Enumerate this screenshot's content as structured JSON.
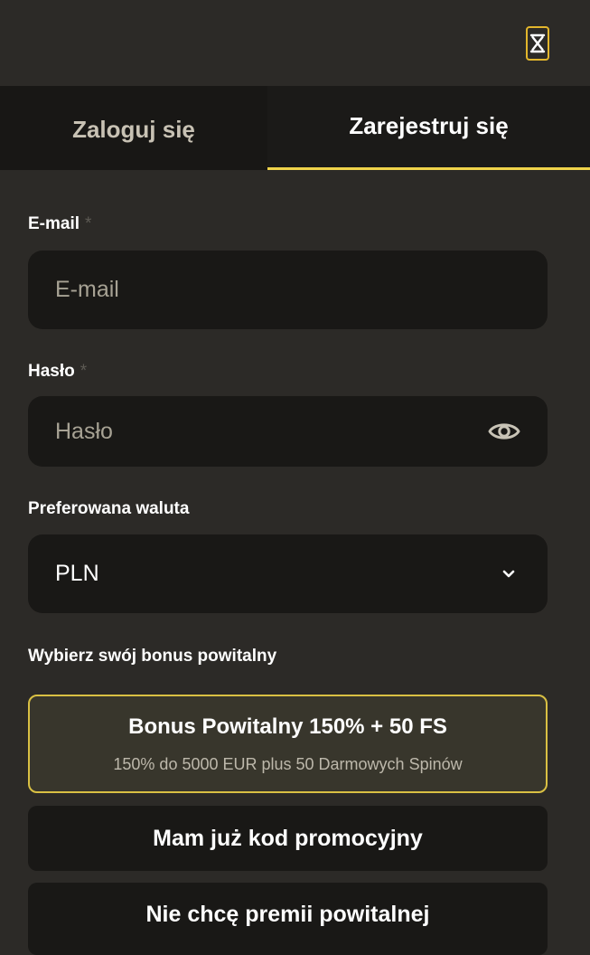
{
  "header": {
    "close_label": "Close"
  },
  "tabs": [
    {
      "label": "Zaloguj się",
      "active": false
    },
    {
      "label": "Zarejestruj się",
      "active": true
    }
  ],
  "form": {
    "email": {
      "label": "E-mail",
      "required_mark": "*",
      "placeholder": "E-mail",
      "value": ""
    },
    "password": {
      "label": "Hasło",
      "required_mark": "*",
      "placeholder": "Hasło",
      "value": "",
      "toggle_icon": "eye-icon"
    },
    "currency": {
      "label": "Preferowana waluta",
      "selected": "PLN",
      "icon": "chevron-down-icon"
    },
    "bonus": {
      "label": "Wybierz swój bonus powitalny",
      "options": [
        {
          "title": "Bonus Powitalny 150% + 50 FS",
          "subtitle": "150% do 5000 EUR plus 50 Darmowych Spinów",
          "selected": true
        },
        {
          "title": "Mam już kod promocyjny",
          "selected": false
        },
        {
          "title": "Nie chcę premii powitalnej",
          "selected": false
        }
      ]
    }
  },
  "colors": {
    "accent": "#f0d34a",
    "background": "#2c2a27",
    "field_background": "#191816",
    "selected_card_background": "#38362c"
  }
}
